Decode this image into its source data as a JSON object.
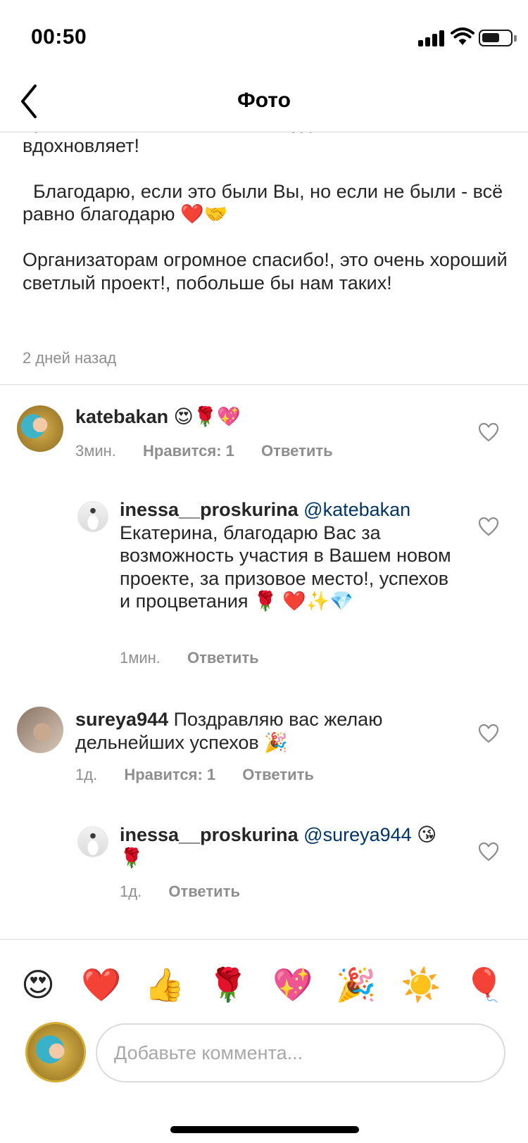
{
  "status_bar": {
    "time": "00:50"
  },
  "nav": {
    "title": "Фото"
  },
  "post": {
    "caption": "Зрители голосовали за меня!, удивительно 😊 и вдохновляет!\n\n  Благодарю, если это были Вы, но если не были - всё равно благодарю ❤️🤝\n\nОрганизаторам огромное спасибо!, это очень хороший светлый проект!, побольше бы нам таких!",
    "time": "2 дней назад"
  },
  "comments": [
    {
      "username": "katebakan",
      "text": "😍🌹💖",
      "time": "3мин.",
      "likes": "Нравится: 1",
      "reply": "Ответить",
      "replies": [
        {
          "username": "inessa__proskurina",
          "mention": "@katebakan",
          "text": "Екатерина, благодарю Вас за возможность участия в Вашем новом проекте, за призовое место!, успехов и процветания 🌹 ❤️✨💎",
          "time": "1мин.",
          "reply": "Ответить"
        }
      ]
    },
    {
      "username": "sureya944",
      "text": "Поздравляю вас желаю дельнейших успехов 🎉",
      "time": "1д.",
      "likes": "Нравится: 1",
      "reply": "Ответить",
      "replies": [
        {
          "username": "inessa__proskurina",
          "mention": "@sureya944",
          "text": "😘🌹",
          "time": "1д.",
          "reply": "Ответить"
        }
      ]
    }
  ],
  "emoji_bar": [
    "😍",
    "❤️",
    "👍",
    "🌹",
    "💖",
    "🎉",
    "☀️",
    "🎈"
  ],
  "composer": {
    "placeholder": "Добавьте коммента..."
  },
  "colors": {
    "link": "#003569",
    "muted": "#8e8e8e",
    "divider": "#dbdbdb"
  }
}
